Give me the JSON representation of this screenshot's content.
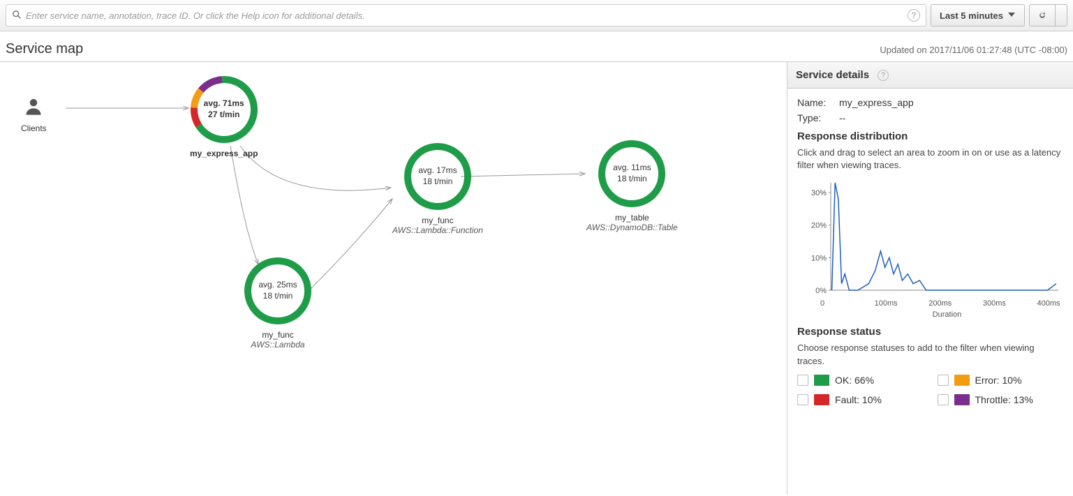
{
  "search": {
    "placeholder": "Enter service name, annotation, trace ID. Or click the Help icon for additional details."
  },
  "toolbar": {
    "time_range_label": "Last 5 minutes"
  },
  "page": {
    "title": "Service map",
    "updated_text": "Updated on 2017/11/06 01:27:48 (UTC -08:00)"
  },
  "map": {
    "clients_label": "Clients",
    "nodes": {
      "express": {
        "avg": "avg. 71ms",
        "rate": "27 t/min",
        "label": "my_express_app"
      },
      "func_top": {
        "avg": "avg. 17ms",
        "rate": "18 t/min",
        "label": "my_func",
        "sublabel": "AWS::Lambda::Function"
      },
      "table": {
        "avg": "avg. 11ms",
        "rate": "18 t/min",
        "label": "my_table",
        "sublabel": "AWS::DynamoDB::Table"
      },
      "func_bottom": {
        "avg": "avg. 25ms",
        "rate": "18 t/min",
        "label": "my_func",
        "sublabel": "AWS::Lambda"
      }
    }
  },
  "details": {
    "header": "Service details",
    "name_label": "Name:",
    "name_value": "my_express_app",
    "type_label": "Type:",
    "type_value": "--",
    "response_dist_header": "Response distribution",
    "response_dist_help": "Click and drag to select an area to zoom in on or use as a latency filter when viewing traces.",
    "response_status_header": "Response status",
    "response_status_help": "Choose response statuses to add to the filter when viewing traces.",
    "statuses": {
      "ok": "OK: 66%",
      "error": "Error: 10%",
      "fault": "Fault: 10%",
      "throttle": "Throttle: 13%"
    }
  },
  "chart_data": {
    "type": "line",
    "title": "",
    "xlabel": "Duration",
    "ylabel": "",
    "y_ticks": [
      "0%",
      "10%",
      "20%",
      "30%"
    ],
    "x_ticks": [
      "0",
      "100ms",
      "200ms",
      "300ms",
      "400ms"
    ],
    "xlim": [
      0,
      420
    ],
    "ylim": [
      0,
      33
    ],
    "series": [
      {
        "name": "distribution",
        "points": [
          {
            "x": 2,
            "y": 0
          },
          {
            "x": 8,
            "y": 33
          },
          {
            "x": 14,
            "y": 28
          },
          {
            "x": 20,
            "y": 2
          },
          {
            "x": 26,
            "y": 5
          },
          {
            "x": 34,
            "y": 0
          },
          {
            "x": 50,
            "y": 0
          },
          {
            "x": 70,
            "y": 2
          },
          {
            "x": 82,
            "y": 6
          },
          {
            "x": 92,
            "y": 12
          },
          {
            "x": 100,
            "y": 7
          },
          {
            "x": 108,
            "y": 10
          },
          {
            "x": 116,
            "y": 5
          },
          {
            "x": 124,
            "y": 8
          },
          {
            "x": 132,
            "y": 3
          },
          {
            "x": 142,
            "y": 5
          },
          {
            "x": 152,
            "y": 2
          },
          {
            "x": 164,
            "y": 3
          },
          {
            "x": 176,
            "y": 0
          },
          {
            "x": 200,
            "y": 0
          },
          {
            "x": 300,
            "y": 0
          },
          {
            "x": 400,
            "y": 0
          },
          {
            "x": 416,
            "y": 2
          }
        ]
      }
    ]
  },
  "donut_segments": [
    {
      "label": "OK",
      "pct": 66,
      "color": "#1e9c47"
    },
    {
      "label": "Fault",
      "pct": 10,
      "color": "#d62728"
    },
    {
      "label": "Error",
      "pct": 10,
      "color": "#f39c12"
    },
    {
      "label": "Throttle",
      "pct": 13,
      "color": "#7b2d8e"
    }
  ]
}
